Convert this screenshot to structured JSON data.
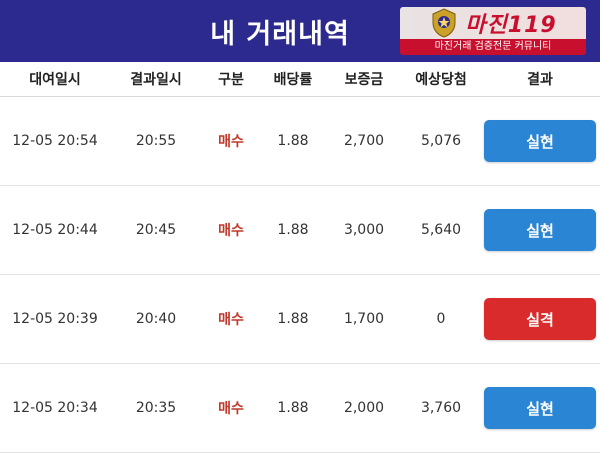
{
  "header": {
    "title": "내 거래내역",
    "logo_name": "마진119",
    "logo_tagline": "마진거래 검증전문 커뮤니티"
  },
  "columns": [
    "대여일시",
    "결과일시",
    "구분",
    "배당률",
    "보증금",
    "예상당첨",
    "결과"
  ],
  "rows": [
    {
      "rent_time": "12-05 20:54",
      "result_time": "20:55",
      "type": "매수",
      "odds": "1.88",
      "deposit": "2,700",
      "expected": "5,076",
      "result": "실현",
      "status": "win"
    },
    {
      "rent_time": "12-05 20:44",
      "result_time": "20:45",
      "type": "매수",
      "odds": "1.88",
      "deposit": "3,000",
      "expected": "5,640",
      "result": "실현",
      "status": "win"
    },
    {
      "rent_time": "12-05 20:39",
      "result_time": "20:40",
      "type": "매수",
      "odds": "1.88",
      "deposit": "1,700",
      "expected": "0",
      "result": "실격",
      "status": "lose"
    },
    {
      "rent_time": "12-05 20:34",
      "result_time": "20:35",
      "type": "매수",
      "odds": "1.88",
      "deposit": "2,000",
      "expected": "3,760",
      "result": "실현",
      "status": "win"
    }
  ],
  "colors": {
    "header_bg": "#2c2a8e",
    "win_button": "#2a86d4",
    "lose_button": "#d92b2b",
    "buy_text": "#c0392b"
  }
}
